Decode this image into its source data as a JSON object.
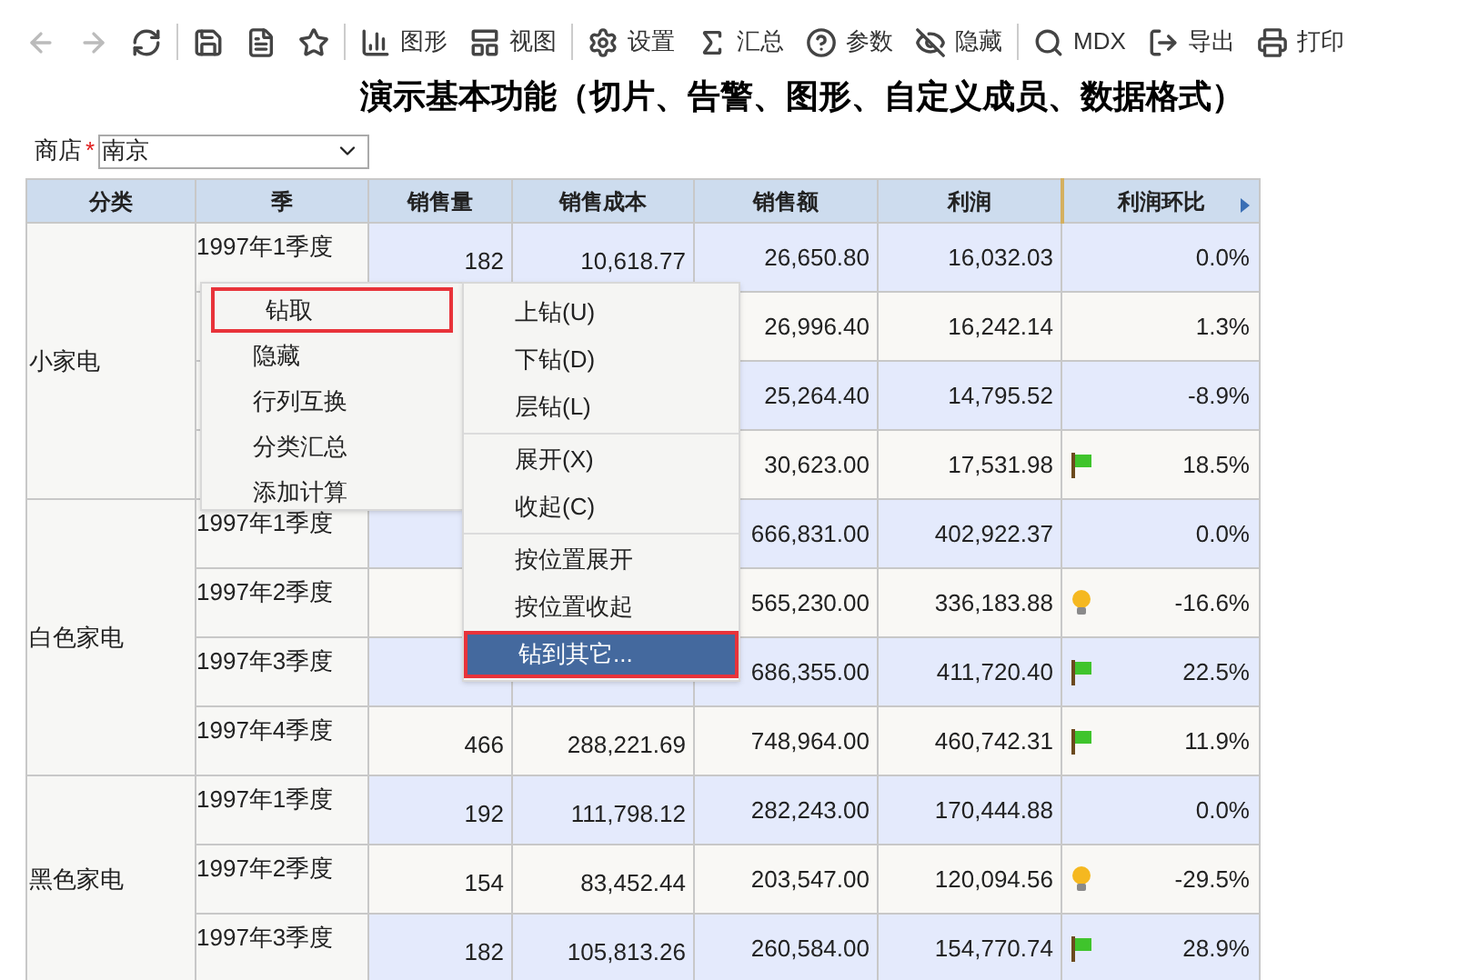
{
  "toolbar": [
    {
      "kind": "back",
      "disabled": true
    },
    {
      "kind": "forward",
      "disabled": true
    },
    {
      "kind": "refresh",
      "disabled": false,
      "separator_after": true
    },
    {
      "kind": "save",
      "disabled": false
    },
    {
      "kind": "save-as",
      "disabled": false
    },
    {
      "kind": "star",
      "disabled": false,
      "separator_after": true
    },
    {
      "kind": "chart",
      "label": "图形",
      "disabled": false
    },
    {
      "kind": "view",
      "label": "视图",
      "disabled": false,
      "separator_after": true
    },
    {
      "kind": "settings",
      "label": "设置",
      "disabled": false
    },
    {
      "kind": "sum",
      "label": "汇总",
      "disabled": false
    },
    {
      "kind": "help",
      "label": "参数",
      "disabled": false
    },
    {
      "kind": "hide",
      "label": "隐藏",
      "disabled": false,
      "separator_after": true
    },
    {
      "kind": "search",
      "label": "MDX",
      "disabled": false
    },
    {
      "kind": "export",
      "label": "导出",
      "disabled": false
    },
    {
      "kind": "print",
      "label": "打印",
      "disabled": false
    }
  ],
  "title": "演示基本功能（切片、告警、图形、自定义成员、数据格式）",
  "filter": {
    "label": "商店",
    "required_mark": "*",
    "value": "南京"
  },
  "table": {
    "columns": [
      "分类",
      "季",
      "销售量",
      "销售成本",
      "销售额",
      "利润",
      "利润环比"
    ],
    "groups": [
      {
        "name": "小家电",
        "rows": [
          {
            "quarter": "1997年1季度",
            "sales": "182",
            "cost": "10,618.77",
            "revenue": "26,650.80",
            "profit": "16,032.03",
            "ratio": "0.0%"
          },
          {
            "revenue": "26,996.40",
            "profit": "16,242.14",
            "ratio": "1.3%"
          },
          {
            "revenue": "25,264.40",
            "profit": "14,795.52",
            "ratio": "-8.9%"
          },
          {
            "revenue": "30,623.00",
            "profit": "17,531.98",
            "ratio": "18.5%",
            "kind": "flag"
          }
        ]
      },
      {
        "name": "白色家电",
        "rows": [
          {
            "quarter": "1997年1季度",
            "revenue": "666,831.00",
            "profit": "402,922.37",
            "ratio": "0.0%"
          },
          {
            "quarter": "1997年2季度",
            "revenue": "565,230.00",
            "profit": "336,183.88",
            "ratio": "-16.6%",
            "kind": "bulb"
          },
          {
            "quarter": "1997年3季度",
            "revenue": "686,355.00",
            "profit": "411,720.40",
            "ratio": "22.5%",
            "kind": "flag"
          },
          {
            "quarter": "1997年4季度",
            "sales": "466",
            "cost": "288,221.69",
            "revenue": "748,964.00",
            "profit": "460,742.31",
            "ratio": "11.9%",
            "kind": "flag"
          }
        ]
      },
      {
        "name": "黑色家电",
        "rows": [
          {
            "quarter": "1997年1季度",
            "sales": "192",
            "cost": "111,798.12",
            "revenue": "282,243.00",
            "profit": "170,444.88",
            "ratio": "0.0%"
          },
          {
            "quarter": "1997年2季度",
            "sales": "154",
            "cost": "83,452.44",
            "revenue": "203,547.00",
            "profit": "120,094.56",
            "ratio": "-29.5%",
            "kind": "bulb"
          },
          {
            "quarter": "1997年3季度",
            "sales": "182",
            "cost": "105,813.26",
            "revenue": "260,584.00",
            "profit": "154,770.74",
            "ratio": "28.9%",
            "kind": "flag"
          }
        ]
      }
    ]
  },
  "context_menu": [
    {
      "label": "钻取",
      "selected": true
    },
    {
      "label": "隐藏",
      "selected": false
    },
    {
      "label": "行列互换",
      "selected": false
    },
    {
      "label": "分类汇总",
      "selected": false
    },
    {
      "label": "添加计算",
      "selected": false
    }
  ],
  "submenu": [
    {
      "label": "上钻(U)",
      "selected": false
    },
    {
      "label": "下钻(D)",
      "selected": false
    },
    {
      "label": "层钻(L)",
      "selected": false,
      "separator_after": true
    },
    {
      "label": "展开(X)",
      "selected": false
    },
    {
      "label": "收起(C)",
      "selected": false,
      "separator_after": true
    },
    {
      "label": "按位置展开",
      "selected": false
    },
    {
      "label": "按位置收起",
      "selected": false
    },
    {
      "label": "钻到其它...",
      "selected": true
    }
  ]
}
